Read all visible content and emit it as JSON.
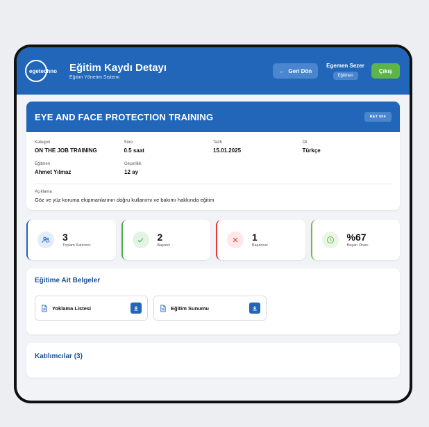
{
  "header": {
    "logo_text": "egetechno",
    "title": "Eğitim Kaydı Detayı",
    "subtitle": "Eğitim Yönetim Sistemi",
    "back_label": "Geri Dön",
    "user_name": "Egemen Sezer",
    "user_role": "Eğitmen",
    "logout_label": "Çıkış"
  },
  "training": {
    "title": "EYE AND FACE PROTECTION TRAINING",
    "badge": "RET 004",
    "fields_row1": [
      {
        "label": "Kategori",
        "value": "ON THE JOB TRAINING"
      },
      {
        "label": "Süre",
        "value": "0.5 saat"
      },
      {
        "label": "Tarih",
        "value": "15.01.2025"
      },
      {
        "label": "Dil",
        "value": "Türkçe"
      }
    ],
    "fields_row2": [
      {
        "label": "Eğitmen",
        "value": "Ahmet Yılmaz"
      },
      {
        "label": "Geçerlilik",
        "value": "12 ay"
      }
    ],
    "description_label": "Açıklama",
    "description": "Göz ve yüz koruma ekipmanlarının doğru kullanımı ve bakımı hakkında eğitim"
  },
  "stats": [
    {
      "value": "3",
      "label": "Toplam Katılımcı",
      "icon": "users-icon",
      "color": "#2166b8",
      "bg": "#e3edf9"
    },
    {
      "value": "2",
      "label": "Başarılı",
      "icon": "check-icon",
      "color": "#4caf50",
      "bg": "#e4f4e4"
    },
    {
      "value": "1",
      "label": "Başarısız",
      "icon": "x-icon",
      "color": "#e53935",
      "bg": "#fde7e7"
    },
    {
      "value": "%67",
      "label": "Başarı Oranı",
      "icon": "clock-icon",
      "color": "#6abf4b",
      "bg": "#e9f6e4"
    }
  ],
  "documents": {
    "title": "Eğitime Ait Belgeler",
    "items": [
      {
        "name": "Yoklama Listesi"
      },
      {
        "name": "Eğitim Sunumu"
      }
    ]
  },
  "participants": {
    "title": "Katılımcılar (3)"
  },
  "colors": {
    "primary": "#2166b8",
    "success": "#5db54a",
    "danger": "#e53935"
  }
}
